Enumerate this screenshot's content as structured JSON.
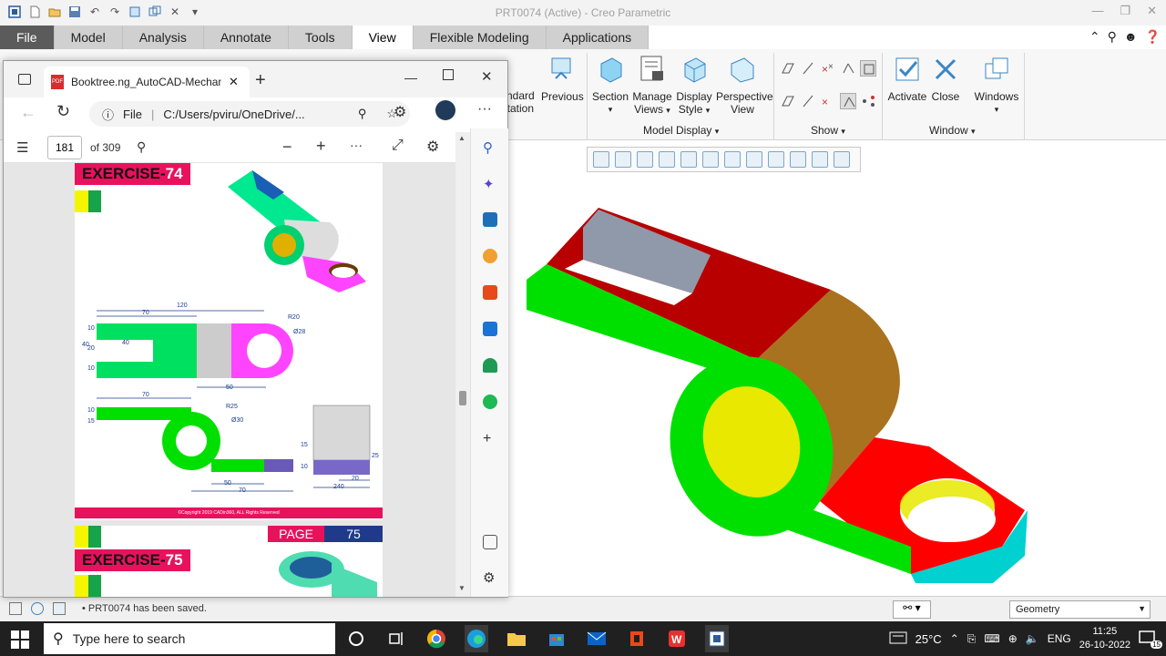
{
  "creo": {
    "window_title": "PRT0074 (Active) - Creo Parametric",
    "tabs": [
      "File",
      "Model",
      "Analysis",
      "Annotate",
      "Tools",
      "View",
      "Flexible Modeling",
      "Applications"
    ],
    "active_tab": "View",
    "ribbon": {
      "partial_left_1": "ndard",
      "partial_left_2": "tation",
      "previous": "Previous",
      "section": "Section",
      "manage_views_1": "Manage",
      "manage_views_2": "Views",
      "display_style_1": "Display",
      "display_style_2": "Style",
      "perspective_1": "Perspective",
      "perspective_2": "View",
      "activate": "Activate",
      "close": "Close",
      "windows": "Windows",
      "group_model_display": "Model Display",
      "group_show": "Show",
      "group_window": "Window"
    },
    "status_message": "PRT0074 has been saved.",
    "filter_value": "Geometry"
  },
  "edge": {
    "tab_title": "Booktree.ng_AutoCAD-Mechanic",
    "address_label": "File",
    "address": "C:/Users/pviru/OneDrive/...",
    "page_current": "181",
    "page_total": "of 309"
  },
  "pdf": {
    "exercise_74_label": "EXERCISE-",
    "exercise_74_num": "74",
    "exercise_75_label": "EXERCISE-",
    "exercise_75_num": "75",
    "page_label": "PAGE",
    "page_num": "75",
    "copyright": "©Copyright 2019 CADin360, ALL Rights Reserved",
    "dims": {
      "d120": "120",
      "d70": "70",
      "d40": "40",
      "r20": "R20",
      "phi28": "Ø28",
      "d50": "50",
      "d40v": "40",
      "d10v": "10",
      "d20v": "20",
      "d10b": "10",
      "r25": "R25",
      "phi30": "Ø30",
      "d70b": "70",
      "d50b": "50",
      "d15": "15",
      "d10c": "10",
      "d20": "20",
      "d240": "240",
      "d25": "25",
      "d10d": "10",
      "d15b": "15"
    }
  },
  "taskbar": {
    "search_placeholder": "Type here to search",
    "temperature": "25°C",
    "language": "ENG",
    "time": "11:25",
    "date": "26-10-2022",
    "notifications": "15"
  }
}
